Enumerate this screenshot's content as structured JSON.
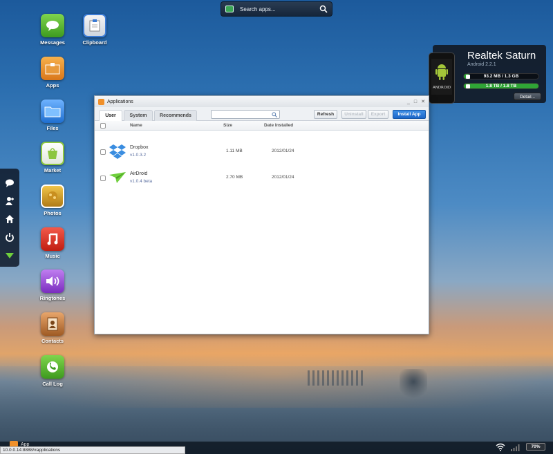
{
  "topbar": {
    "search_placeholder": "Search apps..."
  },
  "desktop_icons": [
    {
      "label": "Messages",
      "icon": "messages-icon",
      "color": "#5dbb35"
    },
    {
      "label": "Clipboard",
      "icon": "clipboard-icon",
      "color": "#3a7bd5"
    },
    {
      "label": "Apps",
      "icon": "apps-icon",
      "color": "#f0902a"
    },
    {
      "label": "Files",
      "icon": "files-icon",
      "color": "#3b8de0"
    },
    {
      "label": "Market",
      "icon": "market-icon",
      "color": "#8cc63f"
    },
    {
      "label": "Photos",
      "icon": "photos-icon",
      "color": "#d8a52a"
    },
    {
      "label": "Music",
      "icon": "music-icon",
      "color": "#e23b2e"
    },
    {
      "label": "Ringtones",
      "icon": "ringtones-icon",
      "color": "#9b4fd6"
    },
    {
      "label": "Contacts",
      "icon": "contacts-icon",
      "color": "#c9773a"
    },
    {
      "label": "Call Log",
      "icon": "call-log-icon",
      "color": "#5dbb35"
    }
  ],
  "dock": [
    "add-message-icon",
    "add-contact-icon",
    "home-icon",
    "power-icon",
    "airdroid-icon"
  ],
  "device": {
    "name": "Realtek Saturn",
    "version": "Android 2.2.1",
    "storage_internal": "93.2 MB / 1.3 GB",
    "storage_internal_fraction": 0.07,
    "storage_sd": "1.8 TB / 1.8 TB",
    "storage_sd_fraction": 1.0,
    "detail_label": "Detail...",
    "phone_brand": "ANDROID"
  },
  "window": {
    "title": "Applications",
    "controls": {
      "minimize": "_",
      "maximize": "□",
      "close": "✕"
    },
    "tabs": [
      "User",
      "System",
      "Recommends"
    ],
    "active_tab": "User",
    "buttons": {
      "refresh": "Refresh",
      "uninstall": "Uninstall",
      "export": "Export",
      "install": "Install App"
    },
    "columns": {
      "name": "Name",
      "size": "Size",
      "date": "Date Installed"
    },
    "apps": [
      {
        "name": "Dropbox",
        "version": "v1.0.3.2",
        "size": "1.11 MB",
        "date": "2012/01/24",
        "icon": "dropbox-icon"
      },
      {
        "name": "AirDroid",
        "version": "v1.0.4 beta",
        "size": "2.70 MB",
        "date": "2012/01/24",
        "icon": "airdroid-icon"
      }
    ]
  },
  "bottom": {
    "apps_label": "App",
    "status_url": "10.0.0.14:8888/#applications",
    "battery": "70%"
  },
  "colors": {
    "accent": "#1c66c8",
    "progress": "#2fa436"
  }
}
